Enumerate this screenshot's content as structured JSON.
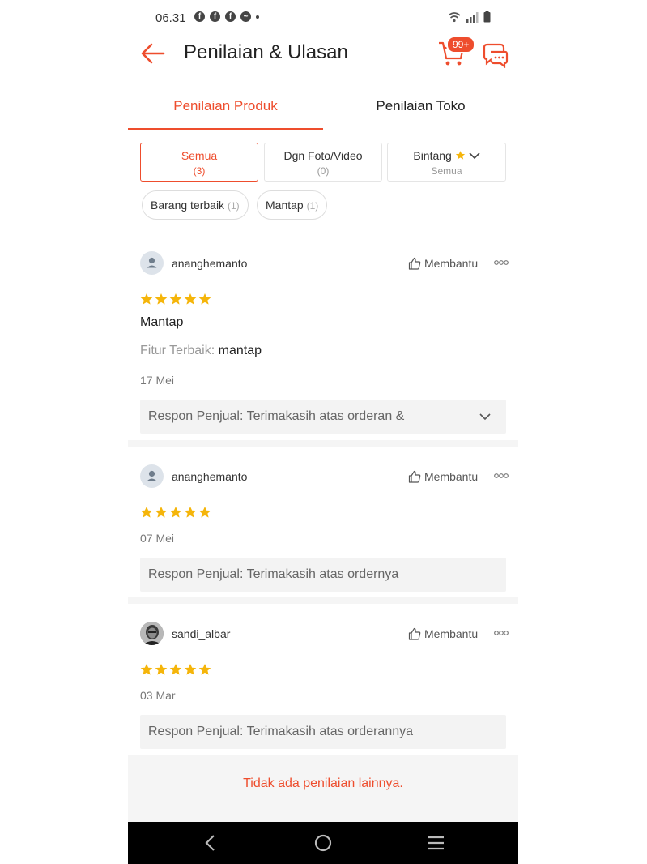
{
  "status_bar": {
    "time": "06.31"
  },
  "header": {
    "title": "Penilaian & Ulasan",
    "cart_badge": "99+"
  },
  "tabs": [
    {
      "label": "Penilaian Produk"
    },
    {
      "label": "Penilaian Toko"
    }
  ],
  "filters": [
    {
      "label": "Semua",
      "count": "(3)"
    },
    {
      "label": "Dgn Foto/Video",
      "count": "(0)"
    },
    {
      "label": "Bintang",
      "count": "Semua"
    }
  ],
  "chips": [
    {
      "label": "Barang terbaik",
      "count": "(1)"
    },
    {
      "label": "Mantap",
      "count": "(1)"
    }
  ],
  "reviews": [
    {
      "username": "ananghemanto",
      "helpful_label": "Membantu",
      "rating": 5,
      "comment": "Mantap",
      "feature_label": "Fitur Terbaik:",
      "feature_value": "mantap",
      "date": "17 Mei",
      "seller_response": "Respon Penjual: Terimakasih atas orderan &"
    },
    {
      "username": "ananghemanto",
      "helpful_label": "Membantu",
      "rating": 5,
      "date": "07 Mei",
      "seller_response": "Respon Penjual: Terimakasih atas ordernya"
    },
    {
      "username": "sandi_albar",
      "helpful_label": "Membantu",
      "rating": 5,
      "date": "03 Mar",
      "seller_response": "Respon Penjual: Terimakasih atas orderannya"
    }
  ],
  "footer": {
    "text": "Tidak ada penilaian lainnya."
  },
  "colors": {
    "accent": "#ee4d2d",
    "star": "#f5b50a"
  }
}
